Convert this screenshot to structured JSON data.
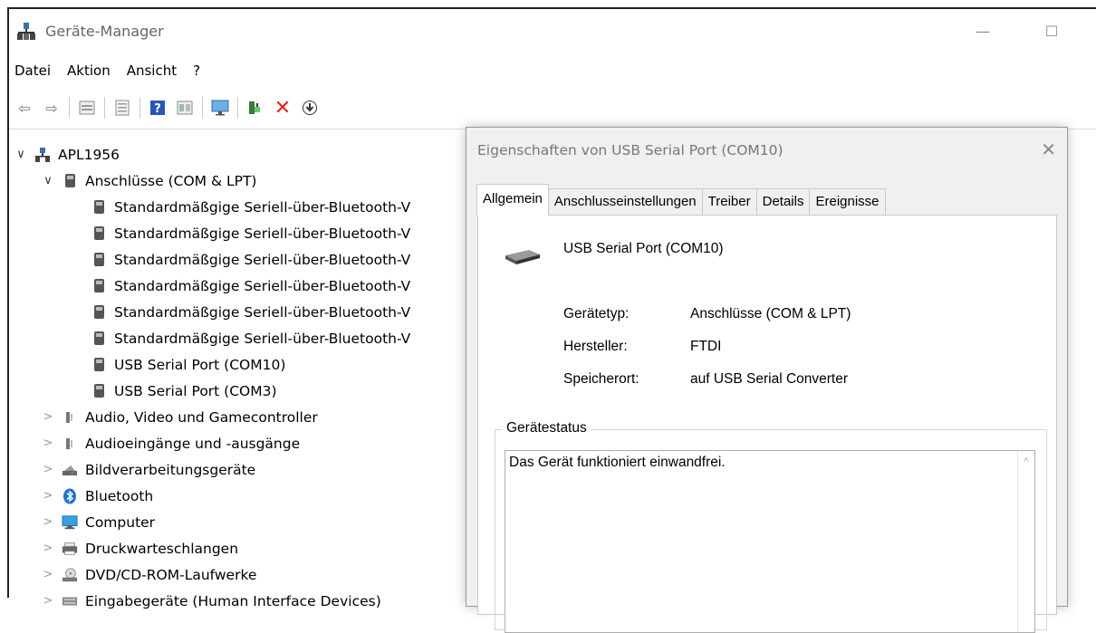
{
  "window": {
    "title": "Geräte-Manager"
  },
  "menu": [
    "Datei",
    "Aktion",
    "Ansicht",
    "?"
  ],
  "toolbar": {
    "icons": [
      "back-arrow-icon",
      "forward-arrow-icon",
      "properties-icon",
      "update-view-icon",
      "help-icon",
      "view-icon",
      "monitor-icon",
      "add-driver-icon",
      "uninstall-icon",
      "download-icon"
    ],
    "accent_delete": "#e02020"
  },
  "tree": {
    "root": "APL1956",
    "ports_category": "Anschlüsse (COM & LPT)",
    "ports": [
      "Standardmäßgige Seriell-über-Bluetooth-V",
      "Standardmäßgige Seriell-über-Bluetooth-V",
      "Standardmäßgige Seriell-über-Bluetooth-V",
      "Standardmäßgige Seriell-über-Bluetooth-V",
      "Standardmäßgige Seriell-über-Bluetooth-V",
      "Standardmäßgige Seriell-über-Bluetooth-V",
      "USB Serial Port (COM10)",
      "USB Serial Port (COM3)"
    ],
    "categories": [
      "Audio, Video und Gamecontroller",
      "Audioeingänge und -ausgänge",
      "Bildverarbeitungsgeräte",
      "Bluetooth",
      "Computer",
      "Druckwarteschlangen",
      "DVD/CD-ROM-Laufwerke",
      "Eingabegeräte (Human Interface Devices)"
    ]
  },
  "dialog": {
    "title": "Eigenschaften von USB Serial Port (COM10)",
    "tabs": [
      "Allgemein",
      "Anschlusseinstellungen",
      "Treiber",
      "Details",
      "Ereignisse"
    ],
    "device_name": "USB Serial Port (COM10)",
    "properties": [
      {
        "label": "Gerätetyp:",
        "value": "Anschlüsse (COM & LPT)"
      },
      {
        "label": "Hersteller:",
        "value": "FTDI"
      },
      {
        "label": "Speicherort:",
        "value": "auf USB Serial Converter"
      }
    ],
    "status_group": "Gerätestatus",
    "status_text": "Das Gerät funktioniert einwandfrei."
  }
}
